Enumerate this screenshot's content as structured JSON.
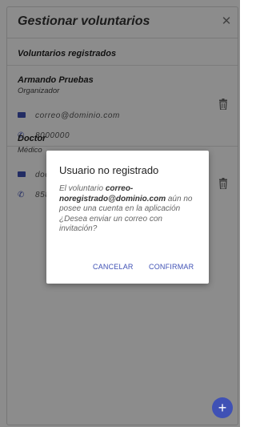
{
  "header": {
    "title": "Gestionar voluntarios",
    "close_icon": "close-icon"
  },
  "section": {
    "title": "Voluntarios registrados"
  },
  "volunteers": [
    {
      "name": "Armando Pruebas",
      "role": "Organizador",
      "email": "correo@dominio.com",
      "phone": "8000000"
    },
    {
      "name": "Doctor",
      "role": "Médico",
      "email": "doc",
      "phone": "858"
    }
  ],
  "dialog": {
    "title": "Usuario no registrado",
    "body_prefix": "El voluntario ",
    "body_email": "correo-noregistrado@dominio.com",
    "body_suffix": " aún no posee una cuenta en la aplicación ¿Desea enviar un correo con invitación?",
    "cancel_label": "CANCELAR",
    "confirm_label": "CONFIRMAR"
  },
  "fab": {
    "label": "+"
  },
  "colors": {
    "accent": "#3f51b5",
    "overlay": "#000000"
  }
}
